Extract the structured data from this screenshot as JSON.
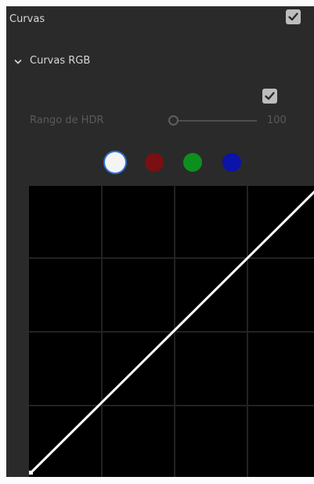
{
  "panel": {
    "title": "Curvas",
    "enabled": true
  },
  "section": {
    "label": "Curvas RGB",
    "expanded": true
  },
  "hdr": {
    "label": "Rango de HDR",
    "value": "100",
    "enabled": true
  },
  "channels": [
    {
      "name": "white",
      "color": "#f4f4f4",
      "selected": true
    },
    {
      "name": "red",
      "color": "#7a0f14",
      "selected": false
    },
    {
      "name": "green",
      "color": "#0d8f1f",
      "selected": false
    },
    {
      "name": "blue",
      "color": "#0c13a8",
      "selected": false
    }
  ],
  "colors": {
    "panel_bg": "#2a2a2a",
    "text": "#d7d7d7",
    "disabled_text": "#5a5a5a",
    "grid": "#222222",
    "curve": "#ffffff",
    "selection_ring": "#2f6fd6"
  }
}
